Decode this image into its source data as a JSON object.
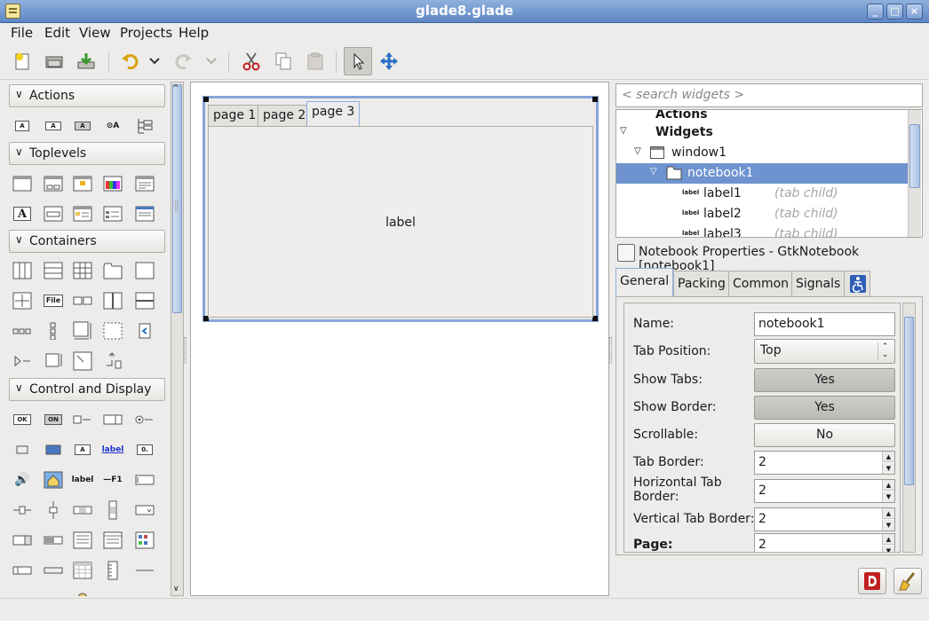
{
  "window": {
    "title": "glade8.glade"
  },
  "menubar": {
    "items": [
      "File",
      "Edit",
      "View",
      "Projects",
      "Help"
    ]
  },
  "toolbar": {
    "buttons": [
      "new-icon",
      "open-icon",
      "save-icon",
      "undo-icon",
      "undo-dropdown-icon",
      "redo-icon",
      "redo-dropdown-icon",
      "cut-icon",
      "copy-icon",
      "paste-icon",
      "select-pointer-icon",
      "drag-resize-icon"
    ],
    "active": "select-pointer-icon"
  },
  "palette": {
    "sections": [
      "Actions",
      "Toplevels",
      "Containers",
      "Control and Display"
    ],
    "item_texts": {
      "file_chooser": "File",
      "ok": "OK",
      "on": "ON",
      "label_link": "label",
      "label": "label",
      "accel_label": "F1",
      "entry_label": "A",
      "spin": "0."
    }
  },
  "canvas": {
    "notebook": {
      "tabs": [
        "page 1",
        "page 2",
        "page 3"
      ],
      "active_tab": 2,
      "content": "label"
    }
  },
  "search": {
    "placeholder": "< search widgets >"
  },
  "tree": {
    "rows": [
      {
        "text": "Actions",
        "bold": true
      },
      {
        "text": "Widgets",
        "bold": true
      },
      {
        "text": "window1"
      },
      {
        "text": "notebook1",
        "selected": true
      },
      {
        "text": "label1",
        "hint": "(tab child)",
        "mini": "label"
      },
      {
        "text": "label2",
        "hint": "(tab child)",
        "mini": "label"
      },
      {
        "text": "label3",
        "hint": "(tab child)",
        "mini": "label"
      }
    ]
  },
  "properties": {
    "header": "Notebook Properties - GtkNotebook [notebook1]",
    "tabs": [
      "General",
      "Packing",
      "Common",
      "Signals"
    ],
    "active_tab": "General",
    "rows": [
      {
        "label": "Name:",
        "type": "input",
        "value": "notebook1"
      },
      {
        "label": "Tab Position:",
        "type": "combo",
        "value": "Top"
      },
      {
        "label": "Show Tabs:",
        "type": "toggle",
        "value": "Yes",
        "pressed": true
      },
      {
        "label": "Show Border:",
        "type": "toggle",
        "value": "Yes",
        "pressed": true
      },
      {
        "label": "Scrollable:",
        "type": "toggle",
        "value": "No",
        "pressed": false
      },
      {
        "label": "Tab Border:",
        "type": "spin",
        "value": "2"
      },
      {
        "label": "Horizontal Tab Border:",
        "type": "spin",
        "value": "2"
      },
      {
        "label": "Vertical Tab Border:",
        "type": "spin",
        "value": "2"
      },
      {
        "label": "Page:",
        "type": "spin",
        "value": "2",
        "bold": true
      }
    ]
  },
  "colors": {
    "selection": "#6e93cf",
    "titlebar": "#5d86c6",
    "accent_border": "#86a6da"
  }
}
